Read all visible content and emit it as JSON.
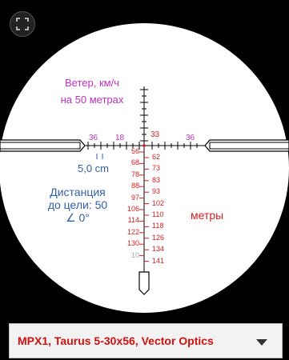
{
  "wind_label_line1": "Ветер, км/ч",
  "wind_label_line2": "на 50 метрах",
  "windage_marks": {
    "left_outer": "36",
    "left_inner": "18",
    "right": "36"
  },
  "top_number": "33",
  "click_value": "5,0 cm",
  "distance_label": {
    "line1": "Дистанция",
    "line2": "до цели: 50",
    "line3": "∠ 0°"
  },
  "units_label": "метры",
  "left_range_marks": [
    "56",
    "68",
    "78",
    "88",
    "97",
    "106",
    "114",
    "122",
    "130",
    "10"
  ],
  "right_range_marks": [
    "62",
    "73",
    "83",
    "93",
    "102",
    "110",
    "118",
    "126",
    "134",
    "141"
  ],
  "scope_selector": "MPX1, Taurus 5-30x56, Vector Optics",
  "colors": {
    "mil": "#d02020",
    "wind": "#c030c0",
    "info": "#3060a8"
  }
}
